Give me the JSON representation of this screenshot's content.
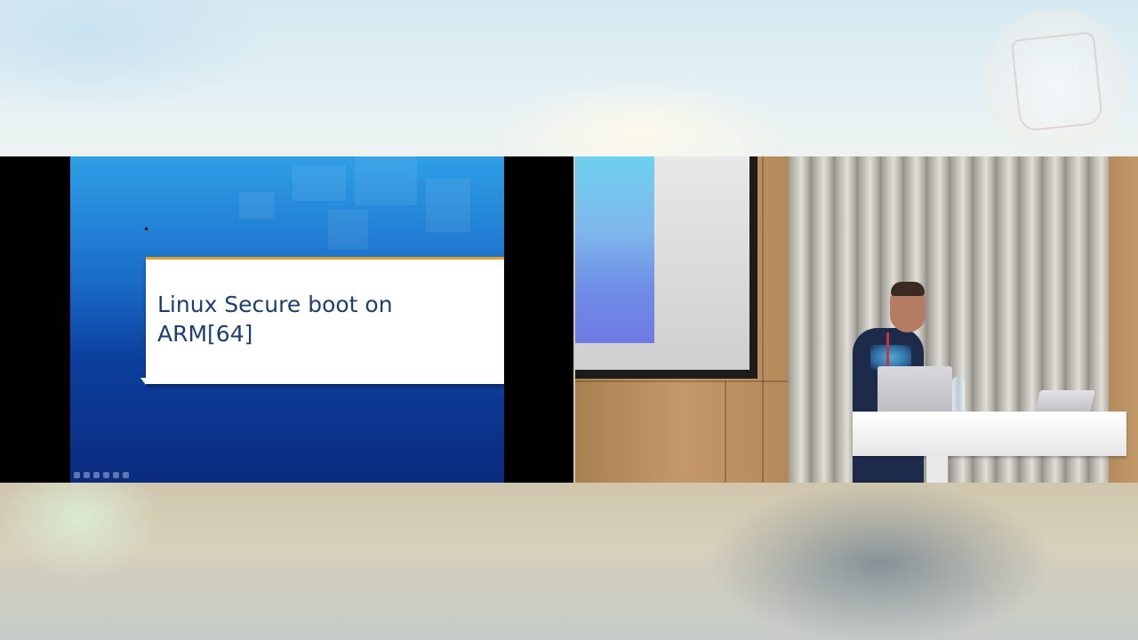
{
  "slide": {
    "title_line1": "Linux Secure boot on",
    "title_line2": "ARM[64]"
  },
  "colors": {
    "slide_gradient_top": "#2e9fe6",
    "slide_gradient_bottom": "#0a2b7e",
    "title_text": "#1b3f6e",
    "title_box_accent": "#e3a127",
    "curtain": "#c9c7c0",
    "wood": "#b98e5b"
  },
  "icons": {
    "slideshow_toolbar": [
      "previous-icon",
      "pen-icon",
      "slide-sorter-icon",
      "zoom-icon",
      "options-icon",
      "next-icon"
    ],
    "watermark": "logo-watermark"
  }
}
